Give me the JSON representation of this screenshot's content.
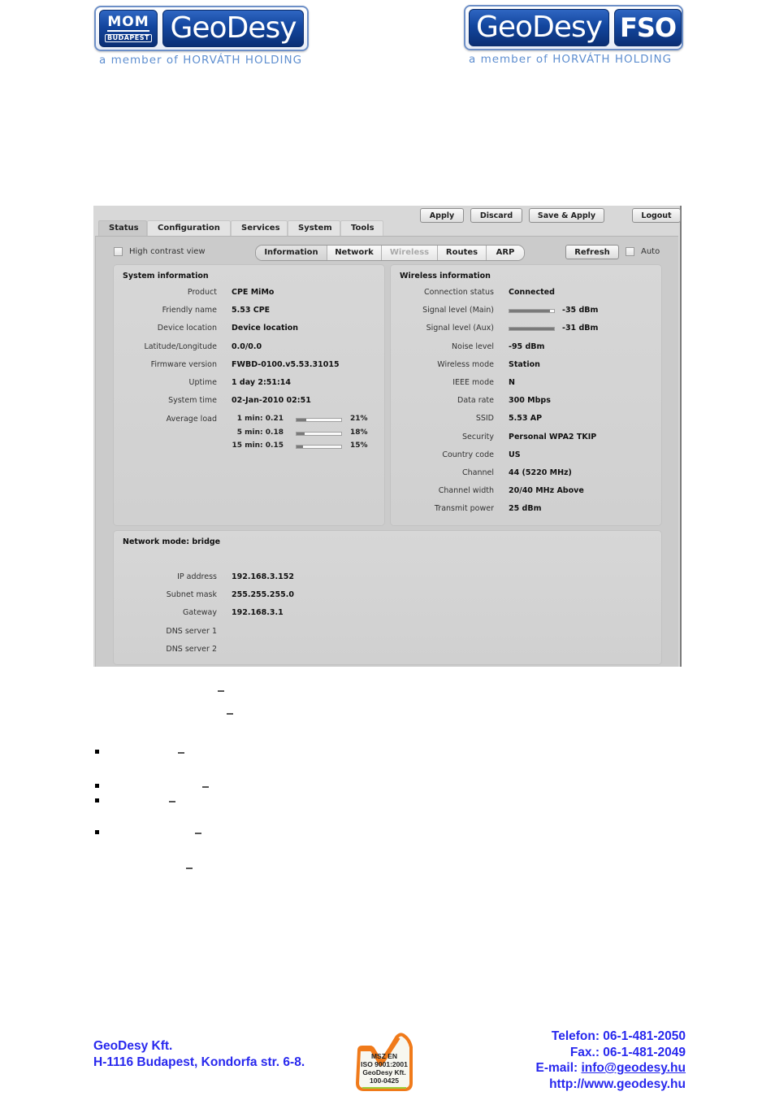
{
  "logos": {
    "left": {
      "badge_top": "MOM",
      "badge_bottom": "BUDAPEST",
      "word": "GeoDesy",
      "subtitle": "a member of HORVÁTH HOLDING"
    },
    "right": {
      "word": "GeoDesy",
      "badge": "FSO",
      "subtitle": "a member of HORVÁTH HOLDING"
    }
  },
  "device_ui": {
    "tabs": [
      {
        "label": "Status",
        "active": true
      },
      {
        "label": "Configuration",
        "active": false
      },
      {
        "label": "Services",
        "active": false
      },
      {
        "label": "System",
        "active": false
      },
      {
        "label": "Tools",
        "active": false
      }
    ],
    "buttons": {
      "apply": "Apply",
      "discard": "Discard",
      "save_apply": "Save & Apply",
      "logout": "Logout",
      "refresh": "Refresh"
    },
    "high_contrast_label": "High contrast view",
    "auto_label": "Auto",
    "subnav": [
      {
        "label": "Information",
        "state": "active"
      },
      {
        "label": "Network",
        "state": "normal"
      },
      {
        "label": "Wireless",
        "state": "disabled"
      },
      {
        "label": "Routes",
        "state": "normal"
      },
      {
        "label": "ARP",
        "state": "normal"
      }
    ],
    "system_info": {
      "title": "System information",
      "rows": [
        {
          "key": "Product",
          "value": "CPE MiMo"
        },
        {
          "key": "Friendly name",
          "value": "5.53 CPE"
        },
        {
          "key": "Device location",
          "value": "Device location"
        },
        {
          "key": "Latitude/Longitude",
          "value": "0.0/0.0"
        },
        {
          "key": "Firmware version",
          "value": "FWBD-0100.v5.53.31015"
        },
        {
          "key": "Uptime",
          "value": "1 day 2:51:14"
        },
        {
          "key": "System time",
          "value": "02-Jan-2010 02:51"
        }
      ],
      "average_load": {
        "key": "Average load",
        "items": [
          {
            "label": "1 min: 0.21",
            "percent_text": "21%",
            "fraction": 0.21
          },
          {
            "label": "5 min: 0.18",
            "percent_text": "18%",
            "fraction": 0.18
          },
          {
            "label": "15 min: 0.15",
            "percent_text": "15%",
            "fraction": 0.15
          }
        ]
      }
    },
    "wireless_info": {
      "title": "Wireless information",
      "rows": [
        {
          "key": "Connection status",
          "value": "Connected"
        },
        {
          "key": "Signal level (Main)",
          "value": "-35 dBm",
          "bar_fraction": 0.9
        },
        {
          "key": "Signal level (Aux)",
          "value": "-31 dBm",
          "bar_fraction": 1.0
        },
        {
          "key": "Noise level",
          "value": "-95 dBm"
        },
        {
          "key": "Wireless mode",
          "value": "Station"
        },
        {
          "key": "IEEE mode",
          "value": "N"
        },
        {
          "key": "Data rate",
          "value": "300 Mbps"
        },
        {
          "key": "SSID",
          "value": "5.53 AP"
        },
        {
          "key": "Security",
          "value": "Personal WPA2 TKIP"
        },
        {
          "key": "Country code",
          "value": "US"
        },
        {
          "key": "Channel",
          "value": "44 (5220 MHz)"
        },
        {
          "key": "Channel width",
          "value": "20/40 MHz Above"
        },
        {
          "key": "Transmit power",
          "value": "25 dBm"
        }
      ]
    },
    "network_info": {
      "title": "Network mode: bridge",
      "rows": [
        {
          "key": "IP address",
          "value": "192.168.3.152"
        },
        {
          "key": "Subnet mask",
          "value": "255.255.255.0"
        },
        {
          "key": "Gateway",
          "value": "192.168.3.1"
        },
        {
          "key": "DNS server 1",
          "value": ""
        },
        {
          "key": "DNS server 2",
          "value": ""
        }
      ]
    }
  },
  "footer": {
    "company": "GeoDesy Kft.",
    "address": "H-1116 Budapest, Kondorfa str. 6-8.",
    "iso_badge": [
      "MSZ EN",
      "ISO 9001:2001",
      "GeoDesy Kft.",
      "100-0425"
    ],
    "phone": "Telefon: 06-1-481-2050",
    "fax": "Fax.: 06-1-481-2049",
    "email_label": "E-mail: ",
    "email": "info@geodesy.hu",
    "website": "http://www.geodesy.hu"
  }
}
